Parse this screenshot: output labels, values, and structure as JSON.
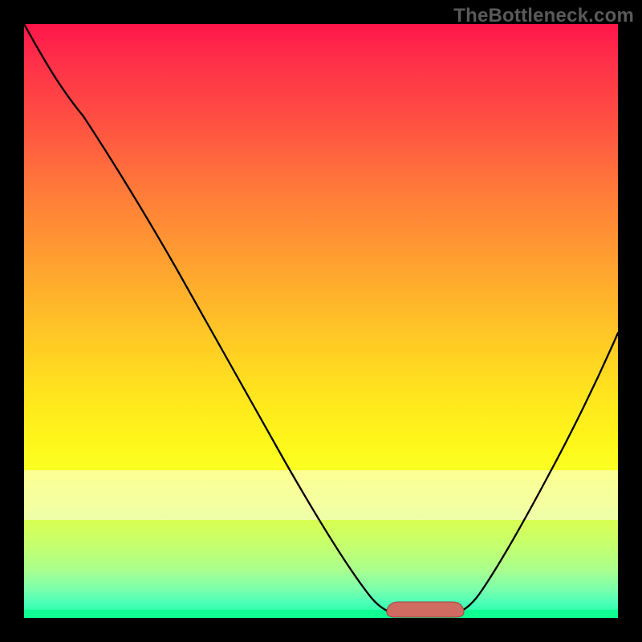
{
  "watermark": "TheBottleneck.com",
  "chart_data": {
    "type": "line",
    "title": "",
    "xlabel": "",
    "ylabel": "",
    "xlim": [
      0,
      100
    ],
    "ylim": [
      0,
      100
    ],
    "grid": false,
    "legend": false,
    "x": [
      0,
      5,
      10,
      15,
      20,
      25,
      30,
      35,
      40,
      45,
      50,
      55,
      58,
      62,
      65,
      68,
      70,
      72,
      75,
      80,
      85,
      90,
      95,
      100
    ],
    "values": [
      100,
      95,
      88,
      80,
      72,
      63,
      55,
      46,
      38,
      29,
      20,
      12,
      6,
      2,
      0.9,
      0.6,
      0.6,
      0.9,
      3,
      11,
      22,
      33,
      44,
      55
    ],
    "notes": "V-shaped bottleneck curve over red→yellow→green vertical gradient; salmon rounded bump segment at valley floor approximately x∈[61,73], y≈0.6; pale horizontal band approx y∈[14,22]; solid green strip at y≈0."
  },
  "colors": {
    "gradient_top": "#ff164a",
    "gradient_mid": "#ffe41e",
    "gradient_bottom": "#14ff9f",
    "curve": "#000000",
    "bump_fill": "#d06b62",
    "bump_stroke": "#9b4a44",
    "watermark": "#5a5a5a"
  }
}
